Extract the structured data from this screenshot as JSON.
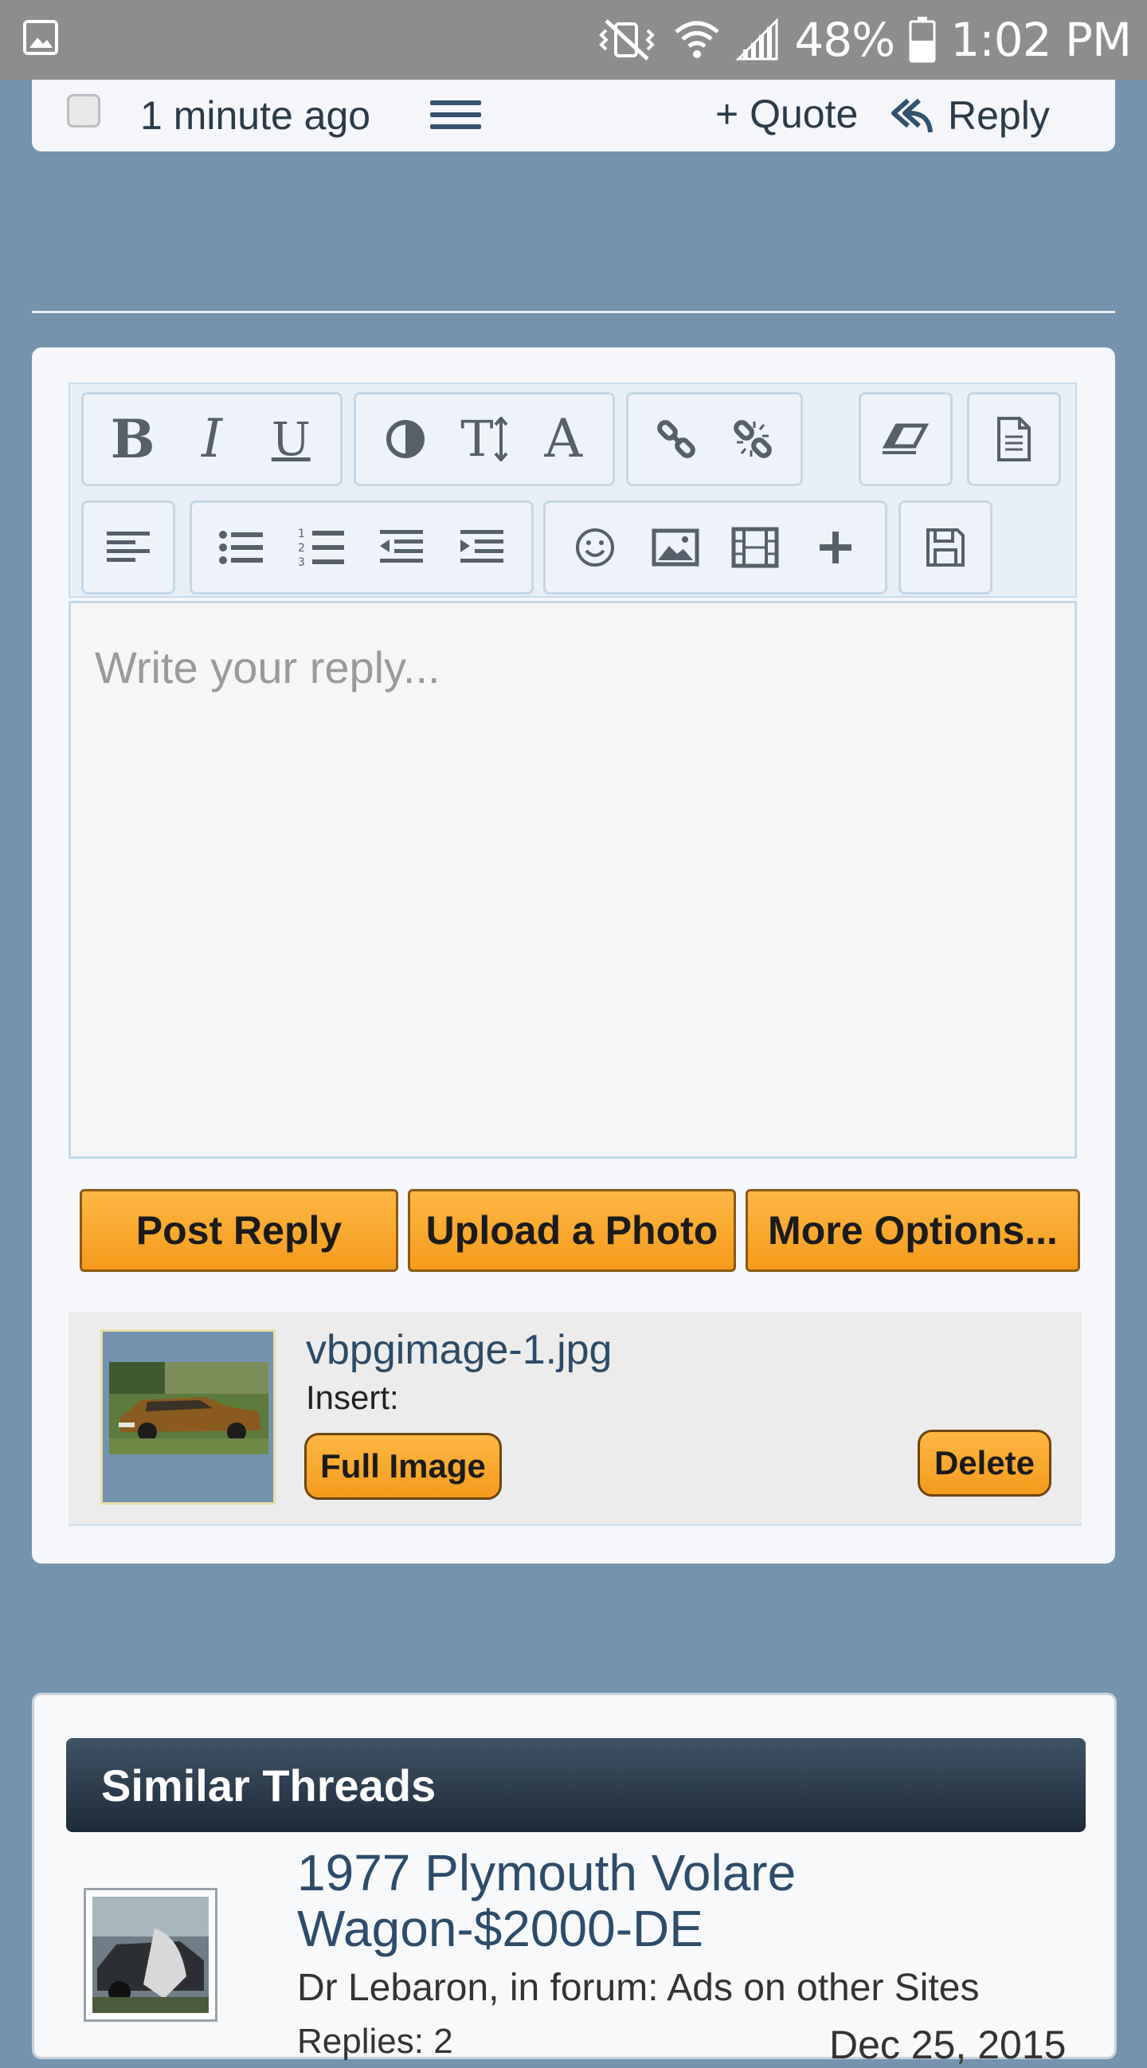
{
  "status_bar": {
    "battery": "48%",
    "time": "1:02 PM",
    "icons": [
      "gallery-notification-icon",
      "mute-vibrate-icon",
      "wifi-icon",
      "signal-icon",
      "battery-icon"
    ]
  },
  "post_strip": {
    "time": "1 minute ago",
    "quote_label": "+ Quote",
    "reply_label": "Reply"
  },
  "editor": {
    "placeholder": "Write your reply...",
    "toolbar_row1": [
      "bold",
      "italic",
      "underline",
      "color",
      "font-size",
      "font",
      "link",
      "unlink",
      "remove-format",
      "source"
    ],
    "toolbar_row2": [
      "align",
      "bullet-list",
      "numbered-list",
      "outdent",
      "indent",
      "smiley",
      "image",
      "video",
      "insert-more",
      "save-draft"
    ],
    "bold_label": "B",
    "italic_label": "I",
    "underline_label": "U",
    "font_size_label": "T",
    "font_label": "A"
  },
  "actions": {
    "post_reply": "Post Reply",
    "upload_photo": "Upload a Photo",
    "more_options": "More Options..."
  },
  "attachment": {
    "filename": "vbpgimage-1.jpg",
    "insert_label": "Insert:",
    "full_image": "Full Image",
    "delete": "Delete"
  },
  "similar_threads": {
    "header": "Similar Threads",
    "threads": [
      {
        "title": "1977 Plymouth Volare Wagon-$2000-DE",
        "meta": "Dr Lebaron, in forum: Ads on other Sites",
        "replies": "Replies:  2",
        "date": "Dec 25, 2015"
      }
    ]
  },
  "colors": {
    "page_bg": "#7393ae",
    "status_bar": "#8d8d8d",
    "accent_orange": "#f7a52b",
    "header_dark": "#2a3a4a",
    "link_blue": "#2d4c6a"
  }
}
